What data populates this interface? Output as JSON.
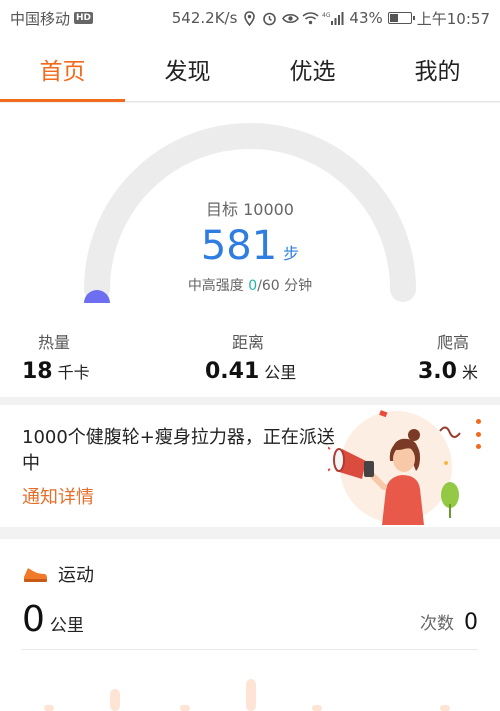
{
  "status_bar": {
    "carrier": "中国移动",
    "hd": "HD",
    "speed": "542.2K/s",
    "network": "4G",
    "battery": "43%",
    "battery_level": 0.43,
    "time": "上午10:57"
  },
  "tabs": [
    {
      "label": "首页",
      "active": true
    },
    {
      "label": "发现",
      "active": false
    },
    {
      "label": "优选",
      "active": false
    },
    {
      "label": "我的",
      "active": false
    }
  ],
  "summary": {
    "goal_label": "目标 10000",
    "goal_steps": 10000,
    "steps": "581",
    "steps_unit": "步",
    "intensity_label": "中高强度",
    "intensity_current": "0",
    "intensity_total": "/60 分钟",
    "progress_color": "#6e6ff0",
    "accent": "#f26a1b",
    "metrics": [
      {
        "label": "热量",
        "value": "18",
        "unit": "千卡"
      },
      {
        "label": "距离",
        "value": "0.41",
        "unit": "公里"
      },
      {
        "label": "爬高",
        "value": "3.0",
        "unit": "米"
      }
    ]
  },
  "notice": {
    "text": "1000个健腹轮+瘦身拉力器，正在派送中",
    "link": "通知详情"
  },
  "sport": {
    "title": "运动",
    "distance": "0",
    "distance_unit": "公里",
    "count_label": "次数",
    "count": "0"
  }
}
